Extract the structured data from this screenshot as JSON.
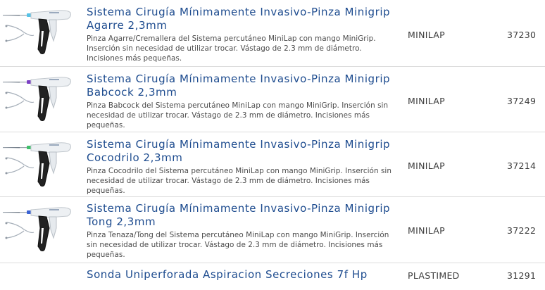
{
  "products": [
    {
      "title": "Sistema Cirugía Mínimamente Invasivo-Pinza Minigrip Agarre 2,3mm",
      "description": "Pinza Agarre/Cremallera del Sistema percutáneo MiniLap con mango MiniGrip. Inserción sin necesidad de utilizar trocar. Vástago de 2.3 mm de diámetro. Incisiones más pequeñas.",
      "brand": "MINILAP",
      "code": "37230",
      "image_icon": "surgical-grasper-icon",
      "tip_color": "#56c2e6"
    },
    {
      "title": "Sistema Cirugía Mínimamente Invasivo-Pinza Minigrip Babcock 2,3mm",
      "description": "Pinza Babcock del Sistema percutáneo MiniLap con mango MiniGrip. Inserción sin necesidad de utilizar trocar. Vástago de 2.3 mm de diámetro. Incisiones más pequeñas.",
      "brand": "MINILAP",
      "code": "37249",
      "image_icon": "surgical-grasper-icon",
      "tip_color": "#7b3fc4"
    },
    {
      "title": "Sistema Cirugía Mínimamente Invasivo-Pinza Minigrip Cocodrilo 2,3mm",
      "description": "Pinza Cocodrilo del Sistema percutáneo MiniLap con mango MiniGrip. Inserción sin necesidad de utilizar trocar. Vástago de 2.3 mm de diámetro. Incisiones más pequeñas.",
      "brand": "MINILAP",
      "code": "37214",
      "image_icon": "surgical-grasper-icon",
      "tip_color": "#3fbf6a"
    },
    {
      "title": "Sistema Cirugía Mínimamente Invasivo-Pinza Minigrip Tong 2,3mm",
      "description": "Pinza Tenaza/Tong del Sistema percutáneo MiniLap con mango MiniGrip. Inserción sin necesidad de utilizar trocar. Vástago de 2.3 mm de diámetro. Incisiones más pequeñas.",
      "brand": "MINILAP",
      "code": "37222",
      "image_icon": "surgical-grasper-icon",
      "tip_color": "#3a62d4"
    },
    {
      "title": "Sonda Uniperforada Aspiracion Secreciones 7f Hp",
      "description": "",
      "brand": "PLASTIMED",
      "code": "31291",
      "image_icon": "",
      "tip_color": ""
    }
  ]
}
